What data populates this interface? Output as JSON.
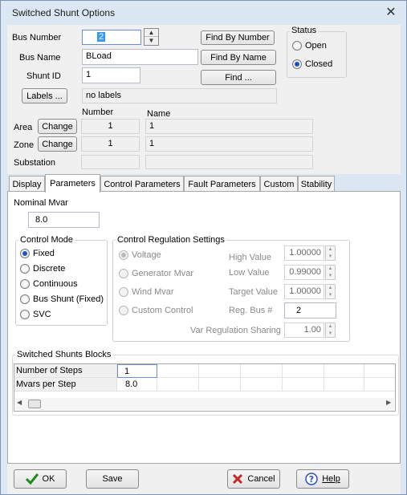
{
  "window": {
    "title": "Switched Shunt Options"
  },
  "header": {
    "bus_number_label": "Bus Number",
    "bus_number_value": "2",
    "bus_name_label": "Bus Name",
    "bus_name_value": "BLoad",
    "shunt_id_label": "Shunt ID",
    "shunt_id_value": "1",
    "labels_button": "Labels ...",
    "labels_value": "no labels",
    "find_by_number": "Find By Number",
    "find_by_name": "Find By Name",
    "find": "Find ...",
    "status": {
      "title": "Status",
      "open": "Open",
      "closed": "Closed",
      "selected": "closed"
    },
    "col_number": "Number",
    "col_name": "Name",
    "area_label": "Area",
    "zone_label": "Zone",
    "substation_label": "Substation",
    "change": "Change",
    "area_number": "1",
    "area_name": "1",
    "zone_number": "1",
    "zone_name": "1",
    "substation_number": "",
    "substation_name": ""
  },
  "tabs": [
    "Display",
    "Parameters",
    "Control Parameters",
    "Fault Parameters",
    "Custom",
    "Stability"
  ],
  "active_tab": "Parameters",
  "parameters": {
    "nominal_mvar_label": "Nominal Mvar",
    "nominal_mvar_value": "8.0",
    "control_mode": {
      "title": "Control Mode",
      "options": [
        "Fixed",
        "Discrete",
        "Continuous",
        "Bus Shunt (Fixed)",
        "SVC"
      ],
      "selected": "Fixed"
    },
    "regulation": {
      "title": "Control Regulation Settings",
      "options": [
        "Voltage",
        "Generator Mvar",
        "Wind Mvar",
        "Custom Control"
      ],
      "selected": "Voltage",
      "high_value_label": "High Value",
      "high_value": "1.00000",
      "low_value_label": "Low Value",
      "low_value": "0.99000",
      "target_value_label": "Target Value",
      "target_value": "1.00000",
      "reg_bus_label": "Reg. Bus #",
      "reg_bus": "2",
      "var_sharing_label": "Var Regulation Sharing",
      "var_sharing": "1.00"
    },
    "blocks": {
      "title": "Switched Shunts Blocks",
      "rows": [
        {
          "label": "Number of Steps",
          "value": "1"
        },
        {
          "label": "Mvars per Step",
          "value": "8.0"
        }
      ]
    }
  },
  "footer": {
    "ok": "OK",
    "save": "Save",
    "cancel": "Cancel",
    "help": "Help"
  },
  "colors": {
    "window_bg": "#dce7f4",
    "panel_bg": "#f0f0f0",
    "ok_check": "#1f8a1f",
    "cancel_x": "#c62828",
    "help_icon": "#2a52be"
  }
}
